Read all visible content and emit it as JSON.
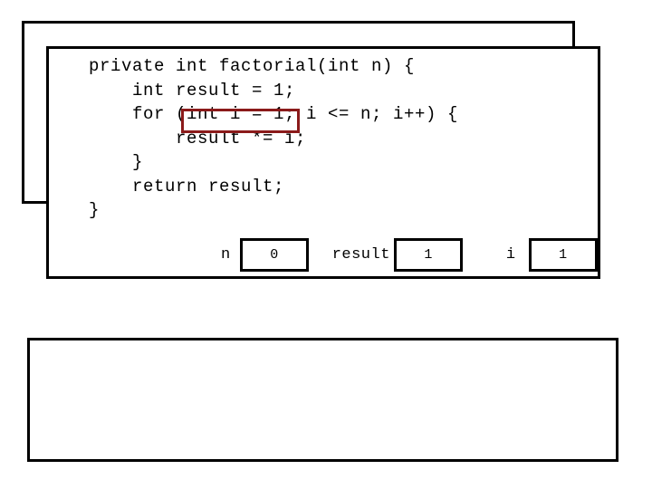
{
  "scene": {
    "title": "factorial-method-trace",
    "background_color": "#ffffff"
  },
  "panels": {
    "back_card": {
      "name": "previous-call-frame"
    },
    "front_card": {
      "name": "current-call-frame"
    },
    "output_card": {
      "name": "output-console"
    }
  },
  "code": {
    "language": "java",
    "lines": [
      "private int factorial(int n) {",
      "    int result = 1;",
      "    for (int i = 1; i <= n; i++) {",
      "        result *= i;",
      "    }",
      "    return result;",
      "}"
    ]
  },
  "highlight": {
    "text": "int i = 1",
    "color": "#8B1A1A",
    "line_index": 2
  },
  "variables": [
    {
      "name": "n",
      "value": "0"
    },
    {
      "name": "result",
      "value": "1"
    },
    {
      "name": "i",
      "value": "1"
    }
  ],
  "output": {
    "text": ""
  }
}
